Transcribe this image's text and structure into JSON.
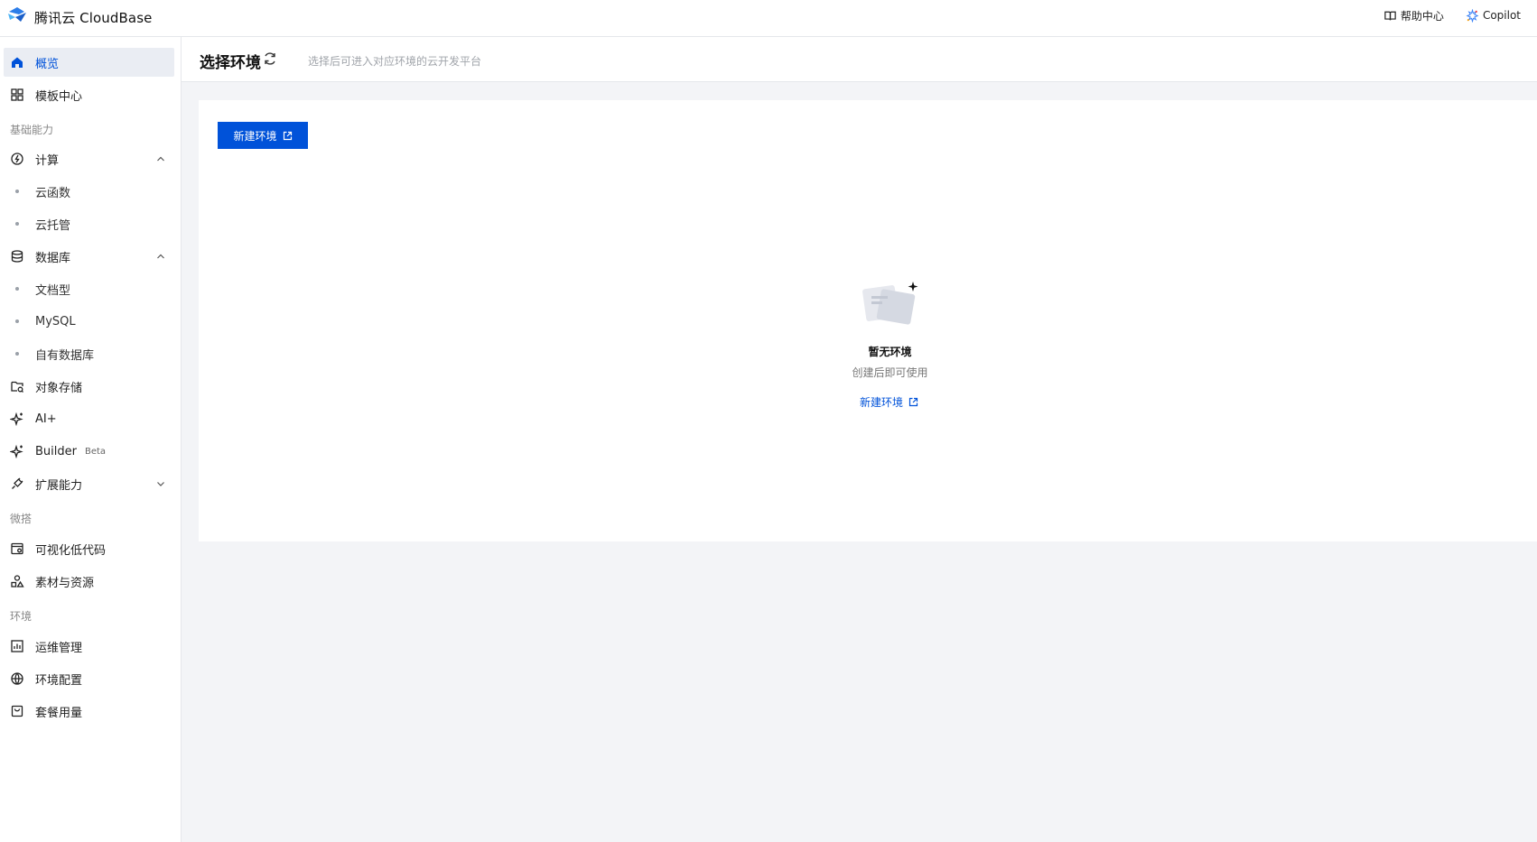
{
  "brand": {
    "title": "腾讯云 CloudBase"
  },
  "topbar": {
    "help_label": "帮助中心",
    "copilot_label": "Copilot"
  },
  "sidebar": {
    "overview": "概览",
    "templates": "模板中心",
    "group_basic": "基础能力",
    "compute": "计算",
    "cloud_functions": "云函数",
    "cloud_run": "云托管",
    "database": "数据库",
    "document_db": "文档型",
    "mysql": "MySQL",
    "own_db": "自有数据库",
    "object_storage": "对象存储",
    "ai_plus": "AI+",
    "builder": "Builder",
    "builder_badge": "Beta",
    "extensions": "扩展能力",
    "group_weda": "微搭",
    "lowcode": "可视化低代码",
    "assets": "素材与资源",
    "group_env": "环境",
    "ops": "运维管理",
    "env_config": "环境配置",
    "usage": "套餐用量"
  },
  "page": {
    "title": "选择环境",
    "description": "选择后可进入对应环境的云开发平台",
    "create_button": "新建环境",
    "empty_title": "暂无环境",
    "empty_desc": "创建后即可使用",
    "empty_link": "新建环境"
  },
  "colors": {
    "accent": "#0052d9",
    "active_bg": "#eaedf3",
    "page_bg": "#f3f4f7"
  }
}
